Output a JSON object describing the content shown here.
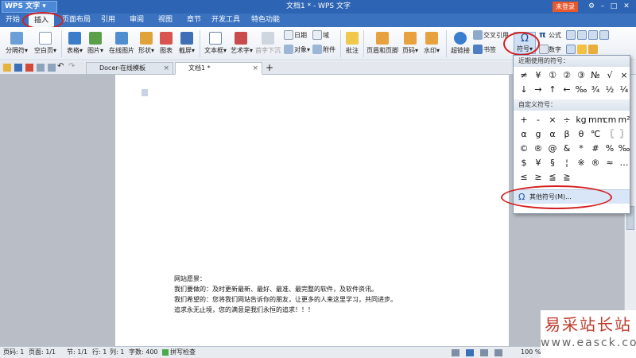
{
  "titlebar": {
    "app_name": "WPS 文字",
    "window_title": "文档1 * - WPS 文字",
    "login": "未登录"
  },
  "menu": {
    "items": [
      "开始",
      "插入",
      "页面布局",
      "引用",
      "审阅",
      "视图",
      "章节",
      "开发工具",
      "特色功能"
    ],
    "active": "插入"
  },
  "ribbon": {
    "page_break": "分隔符",
    "blank_page": "空白页",
    "table": "表格",
    "picture": "图片",
    "online_picture": "在线图片",
    "shape": "形状",
    "chart": "图表",
    "screenshot": "截屏",
    "textbox": "文本框",
    "wordart": "艺术字",
    "drop_cap": "首字下沉",
    "date": "日期",
    "field": "域",
    "object": "对象",
    "attachment": "附件",
    "comment": "批注",
    "header_footer": "页眉和页脚",
    "page_number": "页码",
    "watermark": "水印",
    "hyperlink": "超链接",
    "cross_ref": "交叉引用",
    "bookmark": "书签",
    "symbol": "符号",
    "formula": "公式",
    "number": "数字"
  },
  "tabs": {
    "docer": "Docer-在线模板",
    "doc1": "文档1 *",
    "add": "+"
  },
  "document": {
    "lines": [
      "网站愿景：",
      "我们要做的：及时更新最新、最好、最准、最完整的软件，及软件资讯。",
      "我们希望的：您将我们网站告诉你的朋友，让更多的人来这里学习，共同进步。",
      "追求永无止境，您的满意是我们永恒的追求！！！"
    ]
  },
  "symbol_panel": {
    "recent_title": "近期使用的符号：",
    "recent": [
      "≠",
      "¥",
      "①",
      "②",
      "③",
      "№",
      "√",
      "×",
      "↓",
      "→",
      "↑",
      "←",
      "‰",
      "¾",
      "½",
      "¼"
    ],
    "custom_title": "自定义符号：",
    "custom": [
      "+",
      "-",
      "×",
      "÷",
      "kg",
      "mm",
      "cm",
      "m²",
      "α",
      "g",
      "α",
      "β",
      "θ",
      "℃",
      "〖",
      "〗",
      "©",
      "®",
      "@",
      "&",
      "*",
      "#",
      "%",
      "‰",
      "$",
      "¥",
      "§",
      "¦",
      "※",
      "®",
      "≈",
      "…",
      "≤",
      "≥",
      "≦",
      "≧"
    ],
    "more": "其他符号(M)..."
  },
  "status": {
    "page": "页码: 1",
    "pages": "页面: 1/1",
    "section": "节: 1/1",
    "row": "行: 1",
    "col": "列: 1",
    "words": "字数: 400",
    "spell": "拼写检查",
    "zoom": "100 %"
  },
  "watermark": {
    "title": "易采站长站",
    "url": "www.easck.com"
  },
  "colors": {
    "titlebar": "#2d64b3",
    "menubar": "#3a72c0",
    "highlight_ring": "#d42020",
    "login": "#e8582d"
  }
}
